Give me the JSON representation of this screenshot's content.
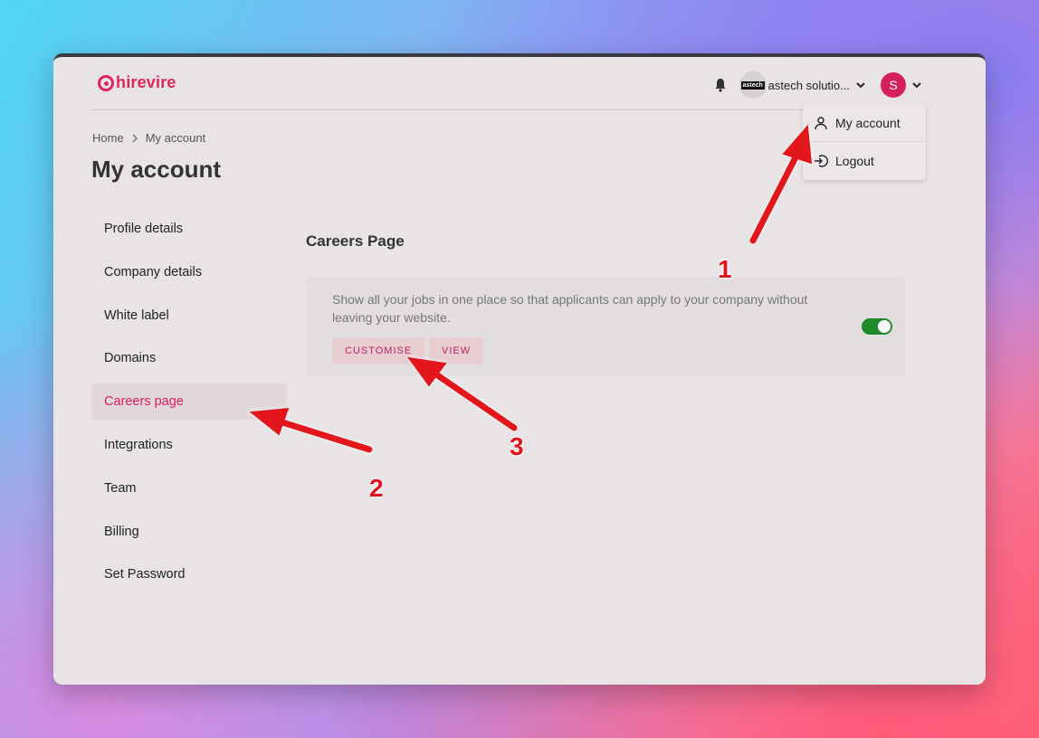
{
  "app": {
    "logo_text": "hirevire",
    "brand_color": "#e0245e"
  },
  "topbar": {
    "bell_icon": "bell-icon",
    "company_logo_text": "astech",
    "company_name": "astech solutio...",
    "user_initial": "S"
  },
  "dropdown": {
    "items": [
      {
        "label": "My account",
        "icon": "user-icon"
      },
      {
        "label": "Logout",
        "icon": "logout-icon"
      }
    ]
  },
  "breadcrumb": {
    "home": "Home",
    "current": "My account"
  },
  "page": {
    "title": "My account"
  },
  "sidebar": {
    "items": [
      {
        "label": "Profile details"
      },
      {
        "label": "Company details"
      },
      {
        "label": "White label"
      },
      {
        "label": "Domains"
      },
      {
        "label": "Careers page",
        "active": true
      },
      {
        "label": "Integrations"
      },
      {
        "label": "Team"
      },
      {
        "label": "Billing"
      },
      {
        "label": "Set Password"
      }
    ]
  },
  "careers": {
    "title": "Careers Page",
    "description": "Show all your jobs in one place so that applicants can apply to your company without leaving your website.",
    "customise_label": "CUSTOMISE",
    "view_label": "VIEW",
    "toggle_on": true,
    "toggle_color": "#1f8a2a"
  },
  "annotations": {
    "marker_1": "1",
    "marker_2": "2",
    "marker_3": "3",
    "arrow_color": "#e3131d"
  }
}
